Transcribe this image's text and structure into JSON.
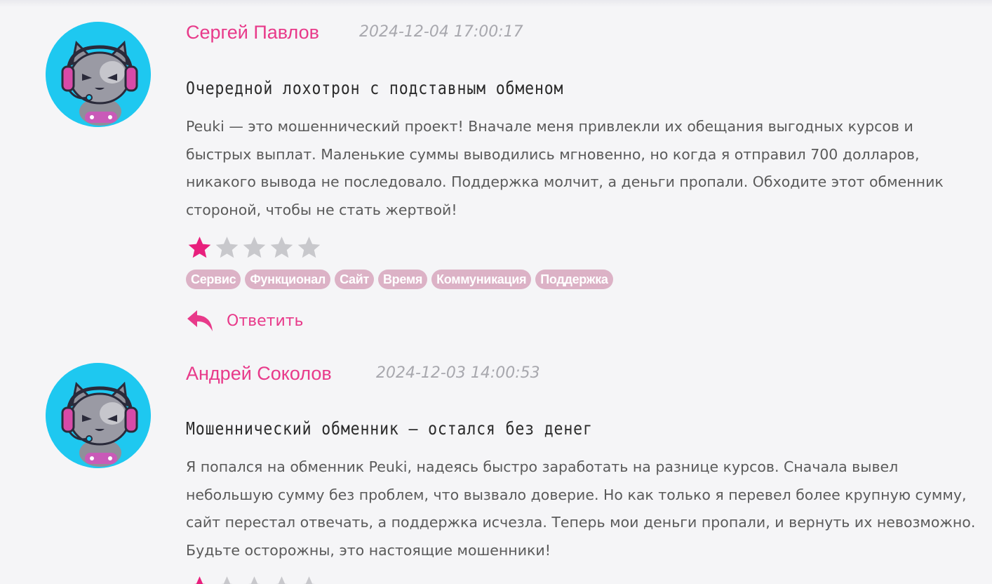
{
  "colors": {
    "accent": "#e83a8a",
    "star_filled": "#e8207d",
    "star_empty": "#c8c8cc",
    "tag_bg": "#dcb2c6",
    "avatar_bg": "#1ec8f0"
  },
  "reviews": [
    {
      "author": "Сергей Павлов",
      "date": "2024-12-04 17:00:17",
      "title": "Очередной лохотрон с подставным обменом",
      "text": "Peuki — это мошеннический проект! Вначале меня привлекли их обещания выгодных курсов и быстрых выплат. Маленькие суммы выводились мгновенно, но когда я отправил 700 долларов, никакого вывода не последовало. Поддержка молчит, а деньги пропали. Обходите этот обменник стороной, чтобы не стать жертвой!",
      "rating": 1,
      "rating_max": 5,
      "tags": [
        "Сервис",
        "Функционал",
        "Сайт",
        "Время",
        "Коммуникация",
        "Поддержка"
      ],
      "reply_label": "Ответить",
      "avatar_icon": "cat-gamer-avatar-icon"
    },
    {
      "author": "Андрей Соколов",
      "date": "2024-12-03 14:00:53",
      "title": "Мошеннический обменник — остался без денег",
      "text": "Я попался на обменник Peuki, надеясь быстро заработать на разнице курсов. Сначала вывел небольшую сумму без проблем, что вызвало доверие. Но как только я перевел более крупную сумму, сайт перестал отвечать, а поддержка исчезла. Теперь мои деньги пропали, и вернуть их невозможно. Будьте осторожны, это настоящие мошенники!",
      "rating": 1,
      "rating_max": 5,
      "avatar_icon": "cat-gamer-avatar-icon"
    }
  ]
}
